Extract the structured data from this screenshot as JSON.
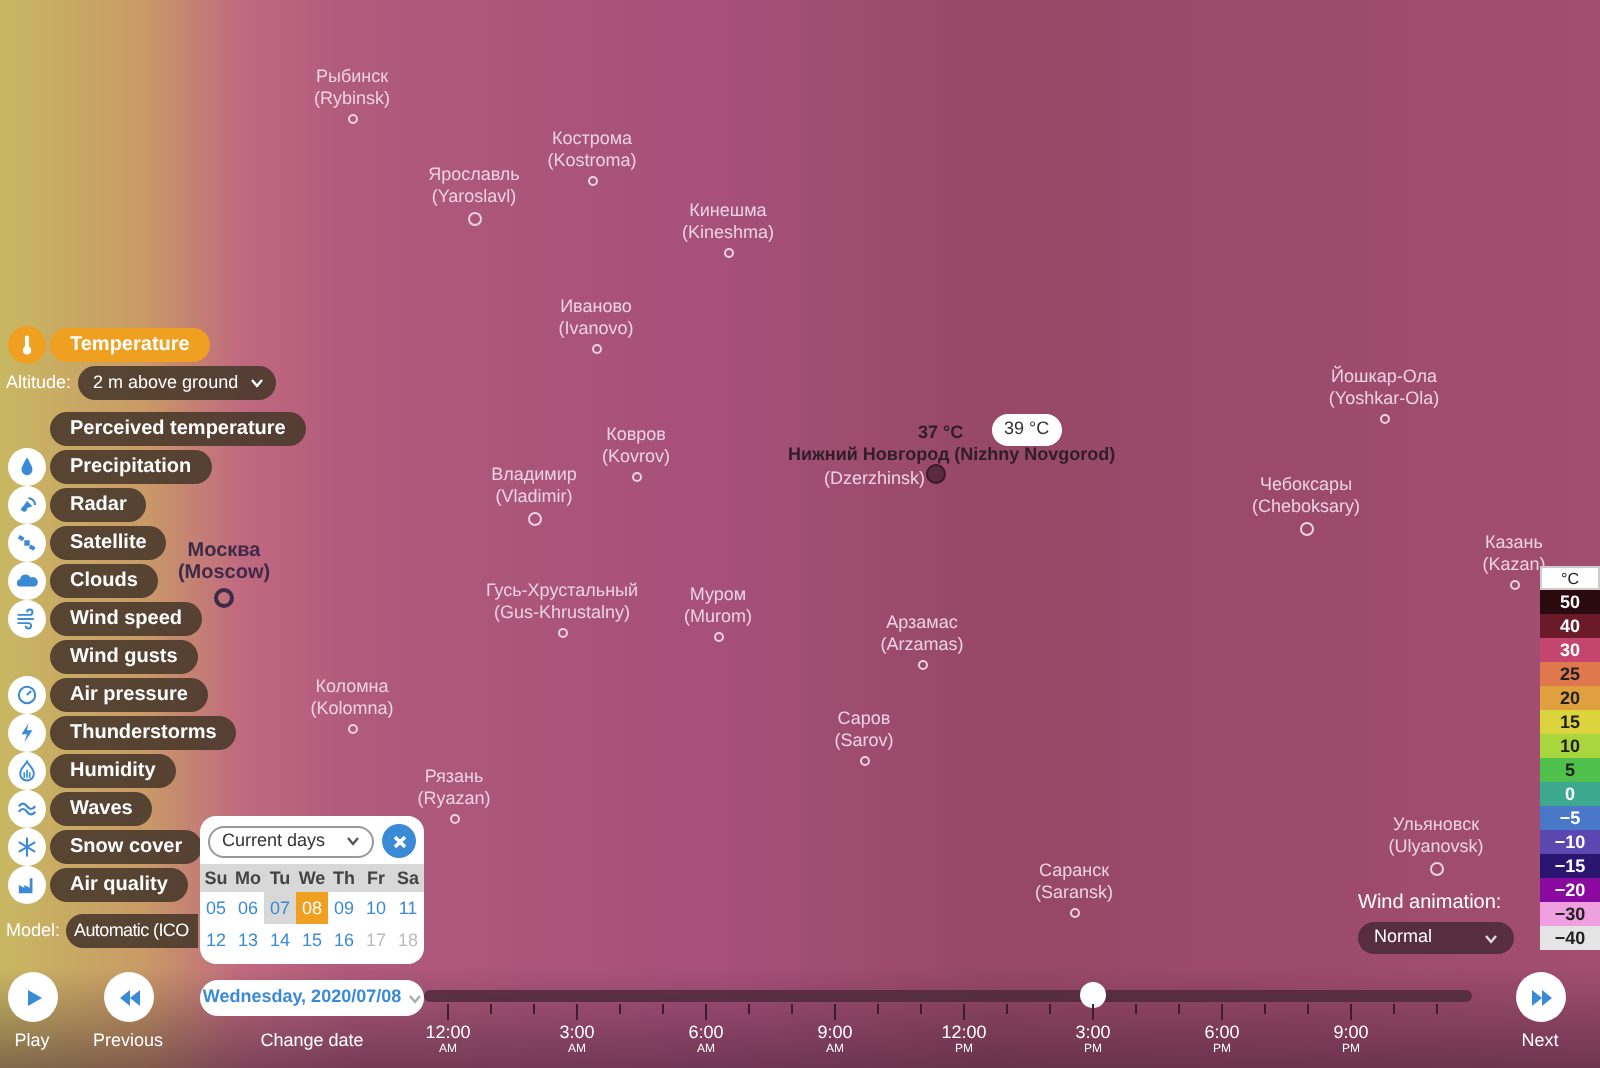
{
  "map": {
    "cities": [
      {
        "name": "Рыбинск",
        "name_en": "(Rybinsk)"
      },
      {
        "name": "Ярославль",
        "name_en": "(Yaroslavl)"
      },
      {
        "name": "Кострома",
        "name_en": "(Kostroma)"
      },
      {
        "name": "Кинешма",
        "name_en": "(Kineshma)"
      },
      {
        "name": "Иваново",
        "name_en": "(Ivanovo)"
      },
      {
        "name": "Ковров",
        "name_en": "(Kovrov)"
      },
      {
        "name": "Владимир",
        "name_en": "(Vladimir)"
      },
      {
        "name": "Гусь-Хрустальный",
        "name_en": "(Gus-Khrustalny)"
      },
      {
        "name": "Муром",
        "name_en": "(Murom)"
      },
      {
        "name": "Коломна",
        "name_en": "(Kolomna)"
      },
      {
        "name": "Рязань",
        "name_en": "(Ryazan)"
      },
      {
        "name": "Москва",
        "name_en": "(Moscow)"
      },
      {
        "name": "Арзамас",
        "name_en": "(Arzamas)"
      },
      {
        "name": "Саров",
        "name_en": "(Sarov)"
      },
      {
        "name": "Саранск",
        "name_en": "(Saransk)"
      },
      {
        "name": "Йошкар-Ола",
        "name_en": "(Yoshkar-Ola)"
      },
      {
        "name": "Чебоксары",
        "name_en": "(Cheboksary)"
      },
      {
        "name": "Казань",
        "name_en": "(Kazan)"
      },
      {
        "name": "Ульяновск",
        "name_en": "(Ulyanovsk)"
      }
    ],
    "dzerzhinsk": "(Dzerzhinsk)",
    "selected_city": "Нижний Новгород (Nizhny Novgorod)",
    "reading": "37 °C",
    "reading_bubble": "39 °C"
  },
  "layers": {
    "items": [
      {
        "label": "Temperature",
        "selected": true,
        "has_icon": true
      },
      {
        "label": "Perceived temperature",
        "selected": false,
        "has_icon": false
      },
      {
        "label": "Precipitation",
        "selected": false,
        "has_icon": true
      },
      {
        "label": "Radar",
        "selected": false,
        "has_icon": true
      },
      {
        "label": "Satellite",
        "selected": false,
        "has_icon": true
      },
      {
        "label": "Clouds",
        "selected": false,
        "has_icon": true
      },
      {
        "label": "Wind speed",
        "selected": false,
        "has_icon": true
      },
      {
        "label": "Wind gusts",
        "selected": false,
        "has_icon": false
      },
      {
        "label": "Air pressure",
        "selected": false,
        "has_icon": true
      },
      {
        "label": "Thunderstorms",
        "selected": false,
        "has_icon": true
      },
      {
        "label": "Humidity",
        "selected": false,
        "has_icon": true
      },
      {
        "label": "Waves",
        "selected": false,
        "has_icon": true
      },
      {
        "label": "Snow cover",
        "selected": false,
        "has_icon": true
      },
      {
        "label": "Air quality",
        "selected": false,
        "has_icon": true
      }
    ],
    "altitude": {
      "label": "Altitude:",
      "value": "2 m above ground"
    },
    "model": {
      "label": "Model:",
      "value": "Automatic (ICO"
    }
  },
  "calendar": {
    "range": "Current days",
    "weekdays": [
      "Su",
      "Mo",
      "Tu",
      "We",
      "Th",
      "Fr",
      "Sa"
    ],
    "weeks": [
      [
        {
          "day": "05",
          "selected": false,
          "today": false,
          "disabled": false
        },
        {
          "day": "06",
          "selected": false,
          "today": false,
          "disabled": false
        },
        {
          "day": "07",
          "selected": false,
          "today": true,
          "disabled": false
        },
        {
          "day": "08",
          "selected": true,
          "today": false,
          "disabled": false
        },
        {
          "day": "09",
          "selected": false,
          "today": false,
          "disabled": false
        },
        {
          "day": "10",
          "selected": false,
          "today": false,
          "disabled": false
        },
        {
          "day": "11",
          "selected": false,
          "today": false,
          "disabled": false
        }
      ],
      [
        {
          "day": "12",
          "selected": false,
          "today": false,
          "disabled": false
        },
        {
          "day": "13",
          "selected": false,
          "today": false,
          "disabled": false
        },
        {
          "day": "14",
          "selected": false,
          "today": false,
          "disabled": false
        },
        {
          "day": "15",
          "selected": false,
          "today": false,
          "disabled": false
        },
        {
          "day": "16",
          "selected": false,
          "today": false,
          "disabled": false
        },
        {
          "day": "17",
          "selected": false,
          "today": false,
          "disabled": true
        },
        {
          "day": "18",
          "selected": false,
          "today": false,
          "disabled": true
        }
      ]
    ],
    "date": "Wednesday, 2020/07/08"
  },
  "controls": {
    "play": "Play",
    "previous": "Previous",
    "change_date": "Change date",
    "next": "Next"
  },
  "timeline": {
    "level": 0.625,
    "ticks": [
      {
        "time": "12:00",
        "period": "AM"
      },
      {
        "time": "3:00",
        "period": "AM"
      },
      {
        "time": "6:00",
        "period": "AM"
      },
      {
        "time": "9:00",
        "period": "AM"
      },
      {
        "time": "12:00",
        "period": "PM"
      },
      {
        "time": "3:00",
        "period": "PM"
      },
      {
        "time": "6:00",
        "period": "PM"
      },
      {
        "time": "9:00",
        "period": "PM"
      }
    ]
  },
  "wind_animation": {
    "label": "Wind animation:",
    "value": "Normal"
  },
  "legend": {
    "unit": "°C",
    "steps": [
      {
        "value": "50",
        "color": "#2a0a0e"
      },
      {
        "value": "40",
        "color": "#6b1a2a"
      },
      {
        "value": "30",
        "color": "#c4466e"
      },
      {
        "value": "25",
        "color": "#e0784e"
      },
      {
        "value": "20",
        "color": "#e0a040"
      },
      {
        "value": "15",
        "color": "#dcd43c"
      },
      {
        "value": "10",
        "color": "#a8d63c"
      },
      {
        "value": "5",
        "color": "#50c04c"
      },
      {
        "value": "0",
        "color": "#3ca88e"
      },
      {
        "value": "−5",
        "color": "#4a78c8"
      },
      {
        "value": "−10",
        "color": "#5a48b0"
      },
      {
        "value": "−15",
        "color": "#2a1670"
      },
      {
        "value": "−20",
        "color": "#8a0aa0"
      },
      {
        "value": "−30",
        "color": "#f0a0e0"
      },
      {
        "value": "−40",
        "color": "#e4e4e4"
      }
    ]
  }
}
